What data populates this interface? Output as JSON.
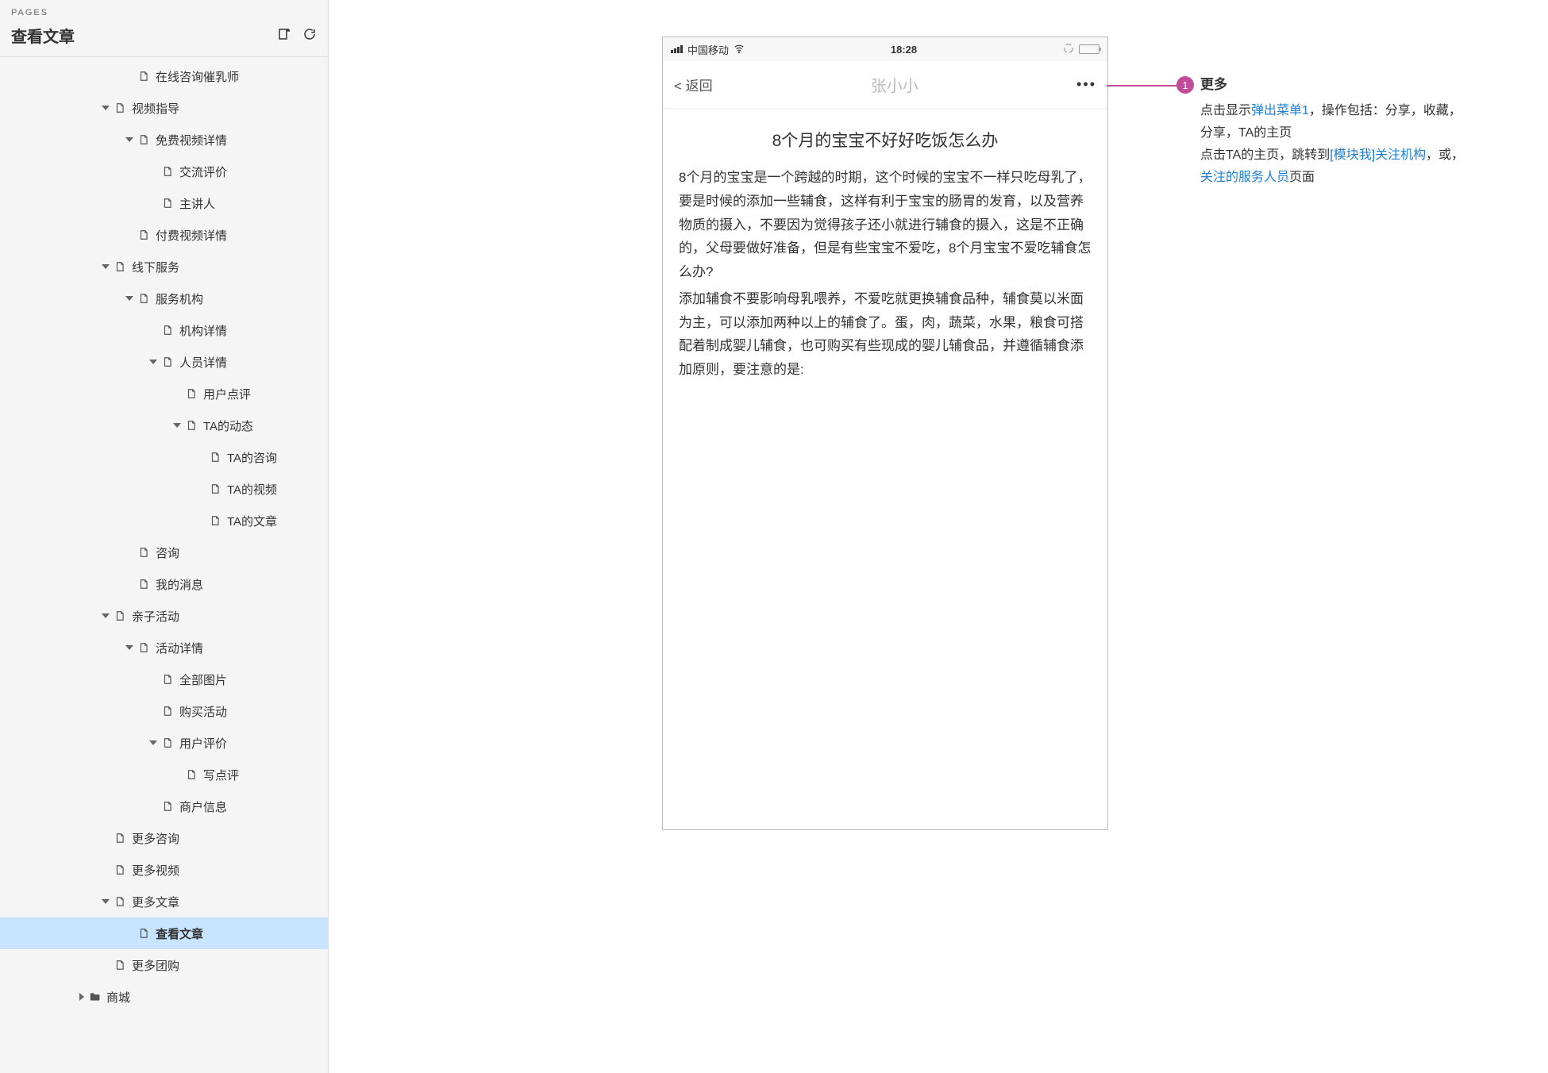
{
  "sidebar": {
    "pages_label": "PAGES",
    "title": "查看文章",
    "items": [
      {
        "label": "在线咨询催乳师",
        "level": 4,
        "tri": "none"
      },
      {
        "label": "视频指导",
        "level": 3,
        "tri": "open"
      },
      {
        "label": "免费视频详情",
        "level": 4,
        "tri": "open"
      },
      {
        "label": "交流评价",
        "level": 5,
        "tri": "none"
      },
      {
        "label": "主讲人",
        "level": 5,
        "tri": "none"
      },
      {
        "label": "付费视频详情",
        "level": 4,
        "tri": "none"
      },
      {
        "label": "线下服务",
        "level": 3,
        "tri": "open"
      },
      {
        "label": "服务机构",
        "level": 4,
        "tri": "open"
      },
      {
        "label": "机构详情",
        "level": 5,
        "tri": "none"
      },
      {
        "label": "人员详情",
        "level": 5,
        "tri": "open"
      },
      {
        "label": "用户点评",
        "level": 6,
        "tri": "none"
      },
      {
        "label": "TA的动态",
        "level": 6,
        "tri": "open"
      },
      {
        "label": "TA的咨询",
        "level": 7,
        "tri": "none"
      },
      {
        "label": "TA的视频",
        "level": 7,
        "tri": "none"
      },
      {
        "label": "TA的文章",
        "level": 7,
        "tri": "none"
      },
      {
        "label": "咨询",
        "level": 4,
        "tri": "none"
      },
      {
        "label": "我的消息",
        "level": 4,
        "tri": "none"
      },
      {
        "label": "亲子活动",
        "level": 3,
        "tri": "open"
      },
      {
        "label": "活动详情",
        "level": 4,
        "tri": "open"
      },
      {
        "label": "全部图片",
        "level": 5,
        "tri": "none"
      },
      {
        "label": "购买活动",
        "level": 5,
        "tri": "none"
      },
      {
        "label": "用户评价",
        "level": 5,
        "tri": "open"
      },
      {
        "label": "写点评",
        "level": 6,
        "tri": "none"
      },
      {
        "label": "商户信息",
        "level": 5,
        "tri": "none"
      },
      {
        "label": "更多咨询",
        "level": 3,
        "tri": "none"
      },
      {
        "label": "更多视频",
        "level": 3,
        "tri": "none"
      },
      {
        "label": "更多文章",
        "level": 3,
        "tri": "open"
      },
      {
        "label": "查看文章",
        "level": 4,
        "tri": "none",
        "selected": true
      },
      {
        "label": "更多团购",
        "level": 3,
        "tri": "none"
      },
      {
        "label": "商城",
        "level": 2,
        "tri": "closed",
        "folder": true
      }
    ]
  },
  "phone": {
    "statusbar": {
      "carrier": "中国移动",
      "time": "18:28"
    },
    "navbar": {
      "back": "返回",
      "title": "张小小",
      "more": "•••"
    },
    "article": {
      "title": "8个月的宝宝不好好吃饭怎么办",
      "p1": "8个月的宝宝是一个跨越的时期，这个时候的宝宝不一样只吃母乳了，要是时候的添加一些辅食，这样有利于宝宝的肠胃的发育，以及营养物质的摄入，不要因为觉得孩子还小就进行辅食的摄入，这是不正确的，父母要做好准备，但是有些宝宝不爱吃，8个月宝宝不爱吃辅食怎么办?",
      "p2": "添加辅食不要影响母乳喂养，不爱吃就更换辅食品种，辅食莫以米面为主，可以添加两种以上的辅食了。蛋，肉，蔬菜，水果，粮食可搭配着制成婴儿辅食，也可购买有些现成的婴儿辅食品，并遵循辅食添加原则，要注意的是:"
    }
  },
  "annotation": {
    "num": "1",
    "title": "更多",
    "line1a": "点击显示",
    "line1_link": "弹出菜单1",
    "line1b": "，操作包括：分享，收藏，分享，TA的主页",
    "line2a": "点击TA的主页，跳转到",
    "line2_link1": "[模块我]关注机构",
    "line2b": "，或，",
    "line2_link2": "关注的服务人员",
    "line2c": "页面"
  }
}
